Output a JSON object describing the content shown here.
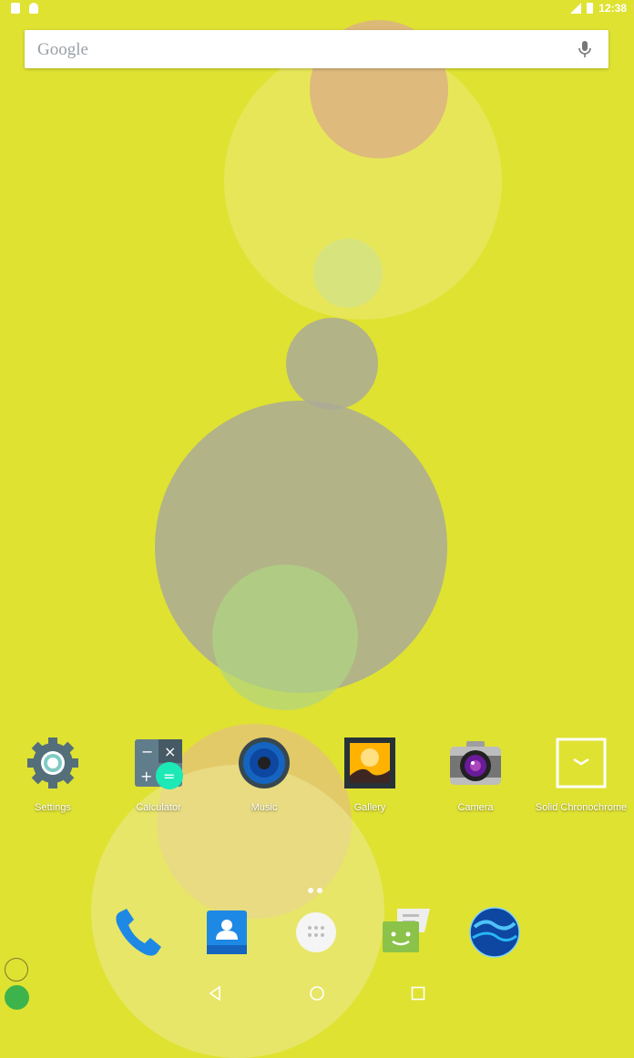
{
  "status": {
    "time": "12:38"
  },
  "search": {
    "logo_text": "Google"
  },
  "apps": [
    {
      "label": "Settings"
    },
    {
      "label": "Calculator"
    },
    {
      "label": "Music"
    },
    {
      "label": "Gallery"
    },
    {
      "label": "Camera"
    },
    {
      "label": "Solid Chronochrome"
    }
  ],
  "dock": [
    {
      "icon": "phone-icon"
    },
    {
      "icon": "contacts-icon"
    },
    {
      "icon": "app-drawer-icon"
    },
    {
      "icon": "messaging-icon"
    },
    {
      "icon": "browser-icon"
    }
  ],
  "nav": [
    "back-icon",
    "home-icon",
    "recents-icon"
  ],
  "colors": {
    "wallpaper": "#dfe231"
  }
}
